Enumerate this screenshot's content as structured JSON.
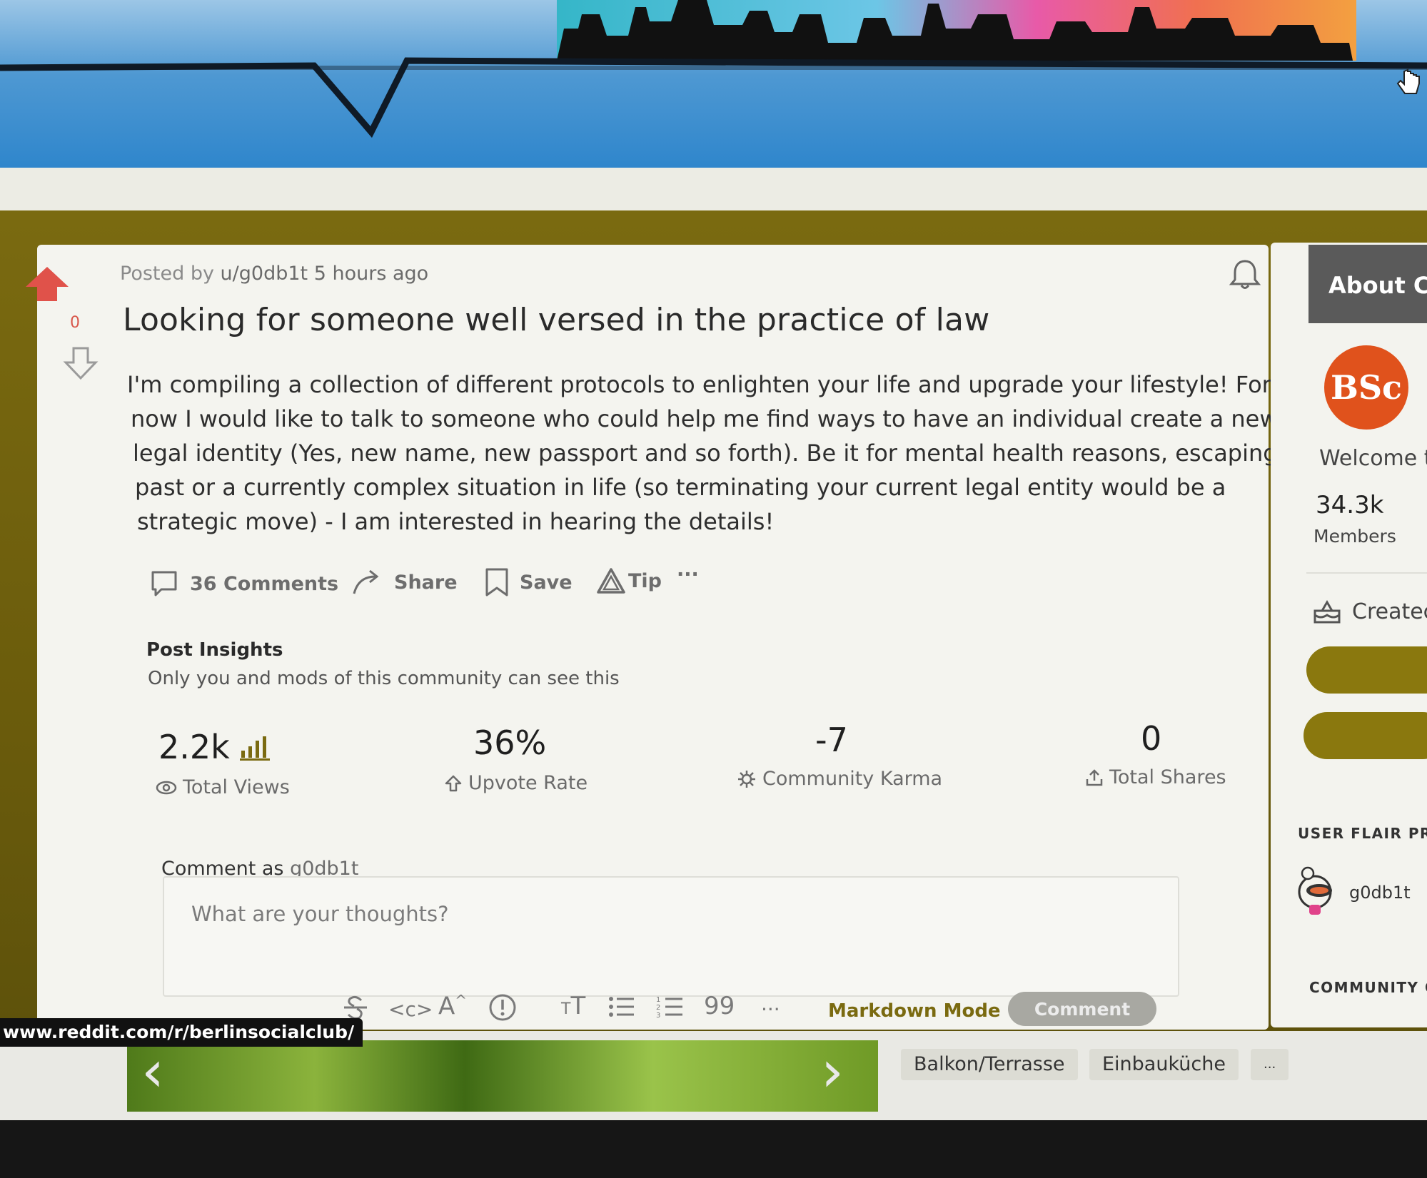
{
  "post": {
    "posted_by_prefix": "Posted by",
    "author": "u/g0db1t",
    "time_ago": "5 hours ago",
    "vote_count": "0",
    "title": "Looking for someone well versed in the practice of law",
    "body_lines": [
      "I'm compiling a collection of different protocols to enlighten your life and upgrade your lifestyle! For",
      "now I would like to talk to someone who could help me find ways to have an individual create a new",
      "legal identity (Yes, new name, new passport and so forth). Be it for mental health reasons, escaping the",
      "past or a currently complex situation in life (so terminating your current legal entity would be a",
      "strategic move) - I am interested in hearing the details!"
    ],
    "actions": {
      "comments": "36 Comments",
      "share": "Share",
      "save": "Save",
      "tip": "Tip",
      "more": "···"
    }
  },
  "insights": {
    "title": "Post Insights",
    "subtitle": "Only you and mods of this community can see this",
    "stats": [
      {
        "value": "2.2k",
        "label": "Total Views",
        "icon": "eye-icon"
      },
      {
        "value": "36%",
        "label": "Upvote Rate",
        "icon": "upvote-outline-icon"
      },
      {
        "value": "-7",
        "label": "Community Karma",
        "icon": "karma-icon"
      },
      {
        "value": "0",
        "label": "Total Shares",
        "icon": "share-upload-icon"
      }
    ]
  },
  "comment": {
    "comment_as_prefix": "Comment as",
    "username": "g0db1t",
    "placeholder": "What are your thoughts?",
    "markdown_mode": "Markdown Mode",
    "submit": "Comment",
    "toolbar_more": "···"
  },
  "status_url": "www.reddit.com/r/berlinsocialclub/",
  "listing_chips": [
    "Balkon/Terrasse",
    "Einbauküche",
    "..."
  ],
  "sidebar": {
    "about": "About Co",
    "logo_text": "BSc",
    "welcome": "Welcome t",
    "members_count": "34.3k",
    "members_label": "Members",
    "created": "Createc",
    "user_flair_heading": "USER FLAIR PRE",
    "flair_username": "g0db1t",
    "community_heading": "COMMUNITY O"
  },
  "colors": {
    "accent_olive": "#7a6a10",
    "upvote_red": "#e0524a",
    "logo_orange": "#e0521c"
  }
}
